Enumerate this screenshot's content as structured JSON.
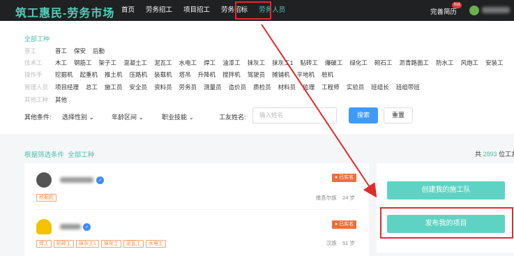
{
  "header": {
    "logo": "筑工惠民-劳务市场",
    "nav": [
      "首页",
      "劳务招工",
      "项目招工",
      "劳务招标",
      "劳务人员"
    ],
    "active_index": 4,
    "resume_label": "完善简历",
    "hot_badge": "hot"
  },
  "filter": {
    "all_types": "全部工种",
    "categories": [
      {
        "name": "普工",
        "items": [
          "普工",
          "保安",
          "后勤"
        ]
      },
      {
        "name": "技术工",
        "items": [
          "木工",
          "钢筋工",
          "架子工",
          "混凝土工",
          "泥瓦工",
          "水电工",
          "焊工",
          "油漆工",
          "抹灰工",
          "抹灰工1",
          "贴砖工",
          "爆破工",
          "绿化工",
          "砌石工",
          "沥青路面工",
          "防水工",
          "风炮工",
          "安装工"
        ]
      },
      {
        "name": "操作手",
        "items": [
          "挖掘机",
          "起重机",
          "推土机",
          "压路机",
          "装载机",
          "塔吊",
          "升降机",
          "搅拌机",
          "驾驶员",
          "摊铺机",
          "平地机",
          "桩机"
        ]
      },
      {
        "name": "管理人员",
        "items": [
          "项目经理",
          "总工",
          "施工员",
          "安全员",
          "资料员",
          "劳务员",
          "测量员",
          "造价员",
          "质检员",
          "材料员",
          "监理",
          "工程师",
          "实验员",
          "班组长",
          "班组带班"
        ]
      },
      {
        "name": "其他工种",
        "items": [
          "其他"
        ]
      }
    ],
    "conditions_label": "其他条件:",
    "dropdowns": [
      "选择性别",
      "年龄区间",
      "职业技能"
    ],
    "worker_name_label": "工友姓名:",
    "name_placeholder": "输入姓名",
    "search_label": "搜索",
    "reset_label": "重置"
  },
  "results": {
    "crumb_prefix": "根据筛选条件",
    "crumb_value": "全部工种",
    "count_prefix": "共",
    "count_value": "2893",
    "count_suffix": "位工友"
  },
  "workers": [
    {
      "verified": "已实名",
      "tags": [
        "挖掘机"
      ],
      "ethnicity": "维吾尔族",
      "age": "24 岁"
    },
    {
      "verified": "已实名",
      "tags": [
        "焊工",
        "贴砖工",
        "抹灰工1",
        "抹灰工",
        "泥瓦工",
        "水电工"
      ],
      "ethnicity": "汉族",
      "age": "51 岁"
    }
  ],
  "side": {
    "create_team": "创建我的施工队",
    "publish_project": "发布我的项目"
  },
  "colors": {
    "accent": "#4fd1b8",
    "highlight": "#e02b2b",
    "search": "#3f9bf7",
    "badge": "#f06d3c"
  }
}
